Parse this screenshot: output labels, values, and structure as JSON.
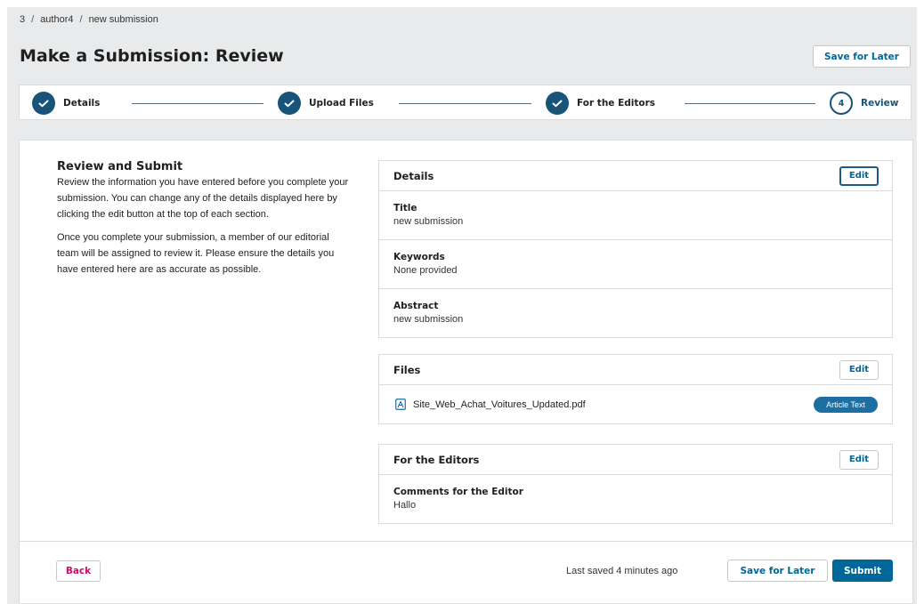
{
  "breadcrumb": [
    "3",
    "author4",
    "new submission"
  ],
  "breadcrumb_separator": "/",
  "page": {
    "title": "Make a Submission: Review",
    "save_later": "Save for Later"
  },
  "steps": [
    {
      "label": "Details",
      "status": "complete"
    },
    {
      "label": "Upload Files",
      "status": "complete"
    },
    {
      "label": "For the Editors",
      "status": "complete"
    },
    {
      "label": "Review",
      "status": "current",
      "number": "4"
    }
  ],
  "intro": {
    "heading": "Review and Submit",
    "paragraph1": "Review the information you have entered before you complete your submission. You can change any of the details displayed here by clicking the edit button at the top of each section.",
    "paragraph2": "Once you complete your submission, a member of our editorial team will be assigned to review it. Please ensure the details you have entered here are as accurate as possible."
  },
  "details_panel": {
    "title": "Details",
    "edit": "Edit",
    "fields": [
      {
        "label": "Title",
        "value": "new submission"
      },
      {
        "label": "Keywords",
        "value": "None provided"
      },
      {
        "label": "Abstract",
        "value": "new submission"
      }
    ]
  },
  "files_panel": {
    "title": "Files",
    "edit": "Edit",
    "file_name": "Site_Web_Achat_Voitures_Updated.pdf",
    "file_type": "Article Text",
    "file_icon": "pdf-file-icon"
  },
  "editors_panel": {
    "title": "For the Editors",
    "edit": "Edit",
    "label": "Comments for the Editor",
    "value": "Hallo"
  },
  "footer": {
    "back": "Back",
    "last_saved": "Last saved 4 minutes ago",
    "save_later": "Save for Later",
    "submit": "Submit"
  },
  "colors": {
    "primary": "#006798",
    "step": "#18537a",
    "back": "#d00a6c",
    "badge": "#1d6fa2"
  }
}
